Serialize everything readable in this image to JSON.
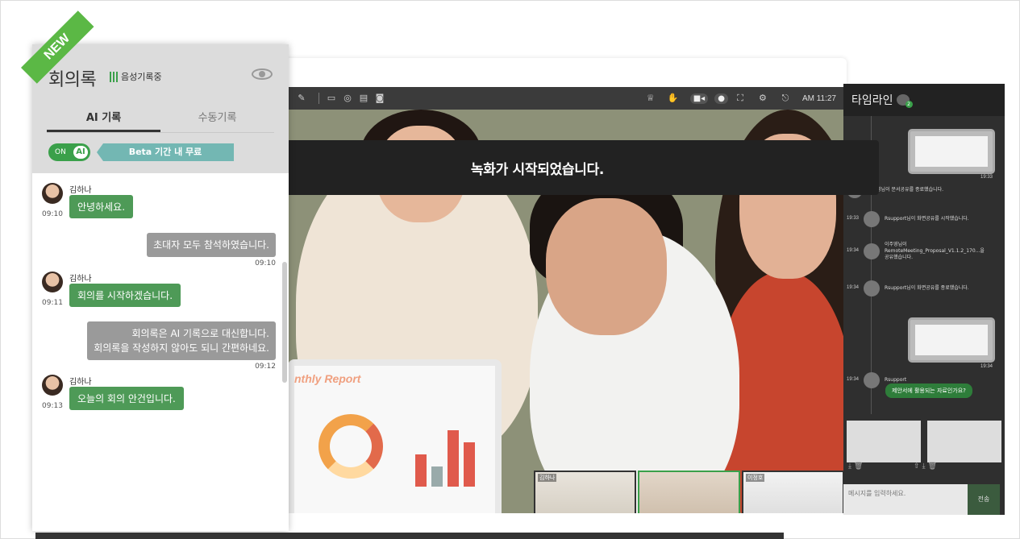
{
  "video": {
    "time": "AM 11:27",
    "slide_title": "nthly Report",
    "thumbnails": [
      {
        "name": "김하나"
      },
      {
        "name": ""
      },
      {
        "name": "이정호"
      }
    ]
  },
  "toast": "녹화가 시작되었습니다.",
  "panel": {
    "badge": "NEW",
    "title": "회의록",
    "recording": "음성기록중",
    "tabs": [
      "AI 기록",
      "수동기록"
    ],
    "toggle_on": "ON",
    "toggle_ai": "AI",
    "beta_text": "Beta 기간 내 무료",
    "messages": [
      {
        "type": "in",
        "name": "김하나",
        "text": "안녕하세요.",
        "time": "09:10"
      },
      {
        "type": "out",
        "text": "초대자 모두 참석하였습니다.",
        "time": "09:10"
      },
      {
        "type": "in",
        "name": "김하나",
        "text": "회의를 시작하겠습니다.",
        "time": "09:11"
      },
      {
        "type": "out",
        "text": "회의록은 AI 기록으로 대신합니다.\n회의록을 작성하지 않아도 되니 간편하네요.",
        "time": "09:12"
      },
      {
        "type": "in",
        "name": "김하나",
        "text": "오늘의 회의 안건입니다.",
        "time": "09:13"
      }
    ]
  },
  "timeline": {
    "title": "타임라인",
    "count": "2",
    "events": [
      {
        "time": "19:33",
        "text": "이주영님이 문서공유를 종료했습니다."
      },
      {
        "time": "19:33",
        "text": "Rsupport님이 화면공유를 시작했습니다."
      },
      {
        "time": "19:34",
        "text": "이주영님이 RemoteMeeting_Proposal_V1.1.2_170...을 공유했습니다."
      },
      {
        "time": "19:34",
        "text": "Rsupport님이 화면공유를 종료했습니다."
      }
    ],
    "card_time_1": "19:33",
    "card_time_2": "19:34",
    "last_sender": "Rsupport",
    "last_time": "19:34",
    "last_message": "제안서에 활용되는 자료인가요?",
    "input_placeholder": "메시지를 입력하세요.",
    "send": "전송"
  }
}
